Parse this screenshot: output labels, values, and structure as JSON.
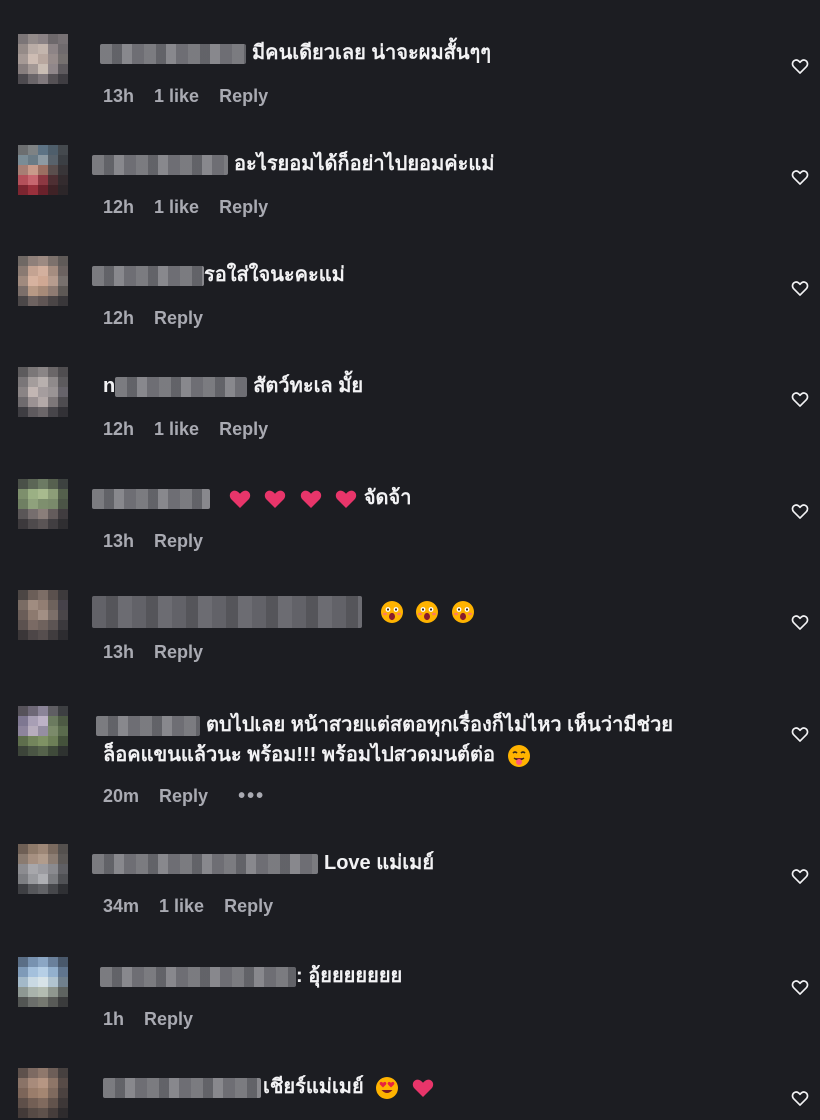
{
  "comments": [
    {
      "text": "มีคนเดียวเลย น่าจะผมสั้นๆๆ",
      "time": "13h",
      "likes": "1 like",
      "reply": "Reply"
    },
    {
      "text": "อะไรยอมได้ก็อย่าไปยอมค่ะแม่",
      "time": "12h",
      "likes": "1 like",
      "reply": "Reply"
    },
    {
      "text": "รอใส่ใจนะคะแม่",
      "time": "12h",
      "likes": "",
      "reply": "Reply"
    },
    {
      "text": "สัตว์ทะเล มั้ย",
      "name_prefix": "n",
      "time": "12h",
      "likes": "1 like",
      "reply": "Reply"
    },
    {
      "text": "จัดจ้า",
      "time": "13h",
      "likes": "",
      "reply": "Reply"
    },
    {
      "text": "",
      "time": "13h",
      "likes": "",
      "reply": "Reply"
    },
    {
      "text_line1": "ตบไปเลย หน้าสวยแต่สตอทุกเรื่องก็ไม่ไหว เห็นว่ามีช่วย",
      "text_line2": "ล็อคแขนแล้วนะ พร้อม!!! พร้อมไปสวดมนต์ต่อ",
      "time": "20m",
      "likes": "",
      "reply": "Reply",
      "more": "•••"
    },
    {
      "text": "Love แม่เมย์",
      "time": "34m",
      "likes": "1 like",
      "reply": "Reply"
    },
    {
      "text": ": อุ้ยยยยยยย",
      "time": "1h",
      "likes": "",
      "reply": "Reply"
    },
    {
      "text": "เชียร์แม่เมย์",
      "time": "",
      "likes": "",
      "reply": ""
    }
  ],
  "icons": {
    "heart": "heart-outline-icon"
  },
  "colors": {
    "background": "#1c1d22",
    "meta": "#a9aab2",
    "text": "#f2f2f4",
    "emoji_heart": "#e8356a"
  }
}
